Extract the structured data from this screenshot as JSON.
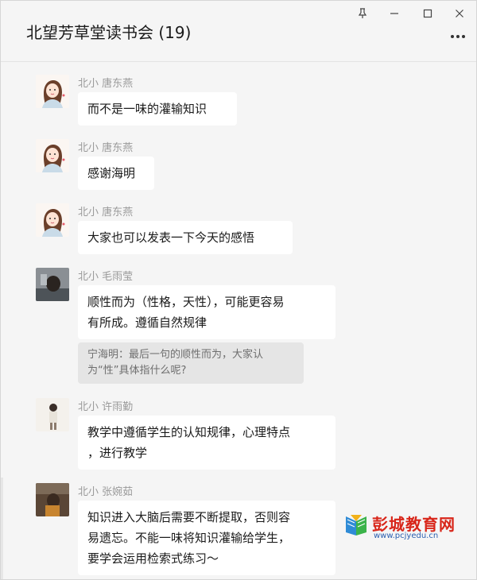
{
  "window": {
    "title": "北望芳草堂读书会 (19)",
    "controls": [
      "pin-icon",
      "minimize-icon",
      "maximize-icon",
      "close-icon"
    ]
  },
  "messages": [
    {
      "sender": "北小 唐东燕",
      "text": "而不是一味的灌输知识"
    },
    {
      "sender": "北小 唐东燕",
      "text": "感谢海明"
    },
    {
      "sender": "北小 唐东燕",
      "text": "大家也可以发表一下今天的感悟"
    },
    {
      "sender": "北小 毛雨莹",
      "text_line1": "顺性而为（性格，天性），可能更容易",
      "text_line2": "有所成。遵循自然规律",
      "quote_line1": "宁海明：最后一句的顺性而为，大家认",
      "quote_line2": "为“性”具体指什么呢?"
    },
    {
      "sender": "北小 许雨勤",
      "text_line1": "教学中遵循学生的认知规律，心理特点",
      "text_line2": "，进行教学"
    },
    {
      "sender": "北小 张婉茹",
      "text_line1": "知识进入大脑后需要不断提取，否则容",
      "text_line2": "易遗忘。不能一味将知识灌输给学生，",
      "text_line3": "要学会运用检索式练习～"
    }
  ],
  "watermark": {
    "name": "彭城教育网",
    "url": "www.pcjyedu.cn"
  },
  "colors": {
    "background": "#f5f5f5",
    "bubble": "#ffffff",
    "quote": "#e5e5e5",
    "sender": "#9a9a9a",
    "brand_red": "#d8261a",
    "brand_blue": "#2a5fb0"
  }
}
